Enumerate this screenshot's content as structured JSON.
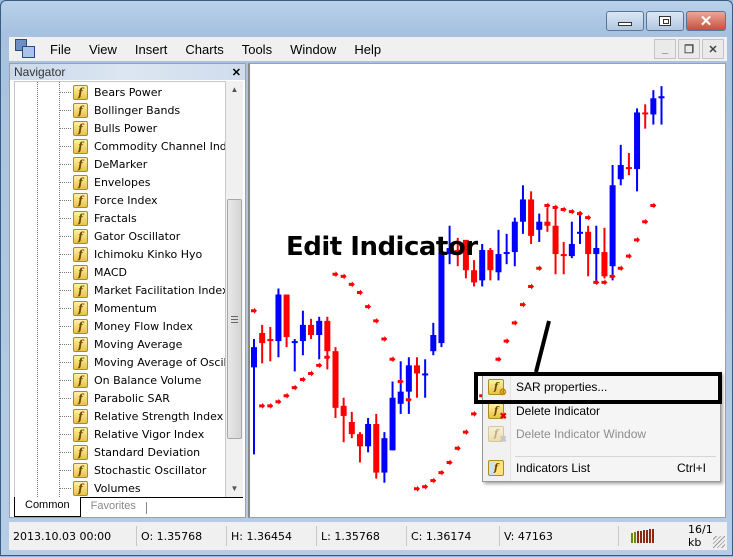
{
  "window": {
    "controls": {
      "minimize": "minimize",
      "maximize": "maximize",
      "close": "close"
    }
  },
  "menubar": {
    "items": [
      "File",
      "View",
      "Insert",
      "Charts",
      "Tools",
      "Window",
      "Help"
    ]
  },
  "navigator": {
    "title": "Navigator",
    "close_label": "x",
    "items": [
      "Bears Power",
      "Bollinger Bands",
      "Bulls Power",
      "Commodity Channel Index",
      "DeMarker",
      "Envelopes",
      "Force Index",
      "Fractals",
      "Gator Oscillator",
      "Ichimoku Kinko Hyo",
      "MACD",
      "Market Facilitation Index",
      "Momentum",
      "Money Flow Index",
      "Moving Average",
      "Moving Average of Oscillat",
      "On Balance Volume",
      "Parabolic SAR",
      "Relative Strength Index",
      "Relative Vigor Index",
      "Standard Deviation",
      "Stochastic Oscillator",
      "Volumes"
    ],
    "tabs": [
      {
        "label": "Common",
        "active": true
      },
      {
        "label": "Favorites",
        "active": false
      }
    ]
  },
  "annotation": {
    "text": "Edit Indicator"
  },
  "context_menu": {
    "items": [
      {
        "label": "SAR properties...",
        "icon": "indicator-properties-icon",
        "enabled": true,
        "shortcut": ""
      },
      {
        "label": "Delete Indicator",
        "icon": "delete-indicator-icon",
        "enabled": true,
        "shortcut": ""
      },
      {
        "label": "Delete Indicator Window",
        "icon": "delete-indicator-window-icon",
        "enabled": false,
        "shortcut": ""
      },
      {
        "label": "Indicators List",
        "icon": "indicators-list-icon",
        "enabled": true,
        "shortcut": "Ctrl+I"
      }
    ]
  },
  "statusbar": {
    "datetime": "2013.10.03 00:00",
    "open": "O: 1.35768",
    "high": "H: 1.36454",
    "low": "L: 1.35768",
    "close": "C: 1.36174",
    "volume": "V: 47163",
    "traffic": "16/1 kb"
  },
  "colors": {
    "bull": "#0000ff",
    "bear": "#ff0000",
    "sar": "#ff0000"
  },
  "chart_data": {
    "type": "candlestick",
    "title": "",
    "indicator": "Parabolic SAR",
    "candles": [
      {
        "o": 1.356,
        "h": 1.3574,
        "l": 1.3517,
        "c": 1.357
      },
      {
        "o": 1.3577,
        "h": 1.3581,
        "l": 1.3562,
        "c": 1.3572
      },
      {
        "o": 1.3574,
        "h": 1.358,
        "l": 1.3563,
        "c": 1.3573
      },
      {
        "o": 1.3573,
        "h": 1.3599,
        "l": 1.3565,
        "c": 1.3596
      },
      {
        "o": 1.3596,
        "h": 1.3592,
        "l": 1.357,
        "c": 1.3575
      },
      {
        "o": 1.3572,
        "h": 1.3574,
        "l": 1.3558,
        "c": 1.3573
      },
      {
        "o": 1.3573,
        "h": 1.3588,
        "l": 1.3566,
        "c": 1.3581
      },
      {
        "o": 1.3581,
        "h": 1.3584,
        "l": 1.3574,
        "c": 1.3576
      },
      {
        "o": 1.3576,
        "h": 1.3585,
        "l": 1.3564,
        "c": 1.3583
      },
      {
        "o": 1.3583,
        "h": 1.3585,
        "l": 1.3559,
        "c": 1.3568
      },
      {
        "o": 1.3568,
        "h": 1.357,
        "l": 1.3535,
        "c": 1.354
      },
      {
        "o": 1.3541,
        "h": 1.3545,
        "l": 1.3523,
        "c": 1.3536
      },
      {
        "o": 1.3533,
        "h": 1.3538,
        "l": 1.3525,
        "c": 1.3527
      },
      {
        "o": 1.3527,
        "h": 1.3528,
        "l": 1.3513,
        "c": 1.3521
      },
      {
        "o": 1.3521,
        "h": 1.3535,
        "l": 1.3518,
        "c": 1.3532
      },
      {
        "o": 1.3532,
        "h": 1.3537,
        "l": 1.3505,
        "c": 1.3508
      },
      {
        "o": 1.3508,
        "h": 1.3528,
        "l": 1.3503,
        "c": 1.3525
      },
      {
        "o": 1.3519,
        "h": 1.3553,
        "l": 1.3519,
        "c": 1.3545
      },
      {
        "o": 1.3542,
        "h": 1.3563,
        "l": 1.3537,
        "c": 1.3548
      },
      {
        "o": 1.3548,
        "h": 1.3565,
        "l": 1.3537,
        "c": 1.3561
      },
      {
        "o": 1.3561,
        "h": 1.3565,
        "l": 1.3545,
        "c": 1.3557
      },
      {
        "o": 1.3557,
        "h": 1.3564,
        "l": 1.3545,
        "c": 1.3557
      },
      {
        "o": 1.3568,
        "h": 1.3582,
        "l": 1.3566,
        "c": 1.3576
      },
      {
        "o": 1.3572,
        "h": 1.3622,
        "l": 1.357,
        "c": 1.3617
      },
      {
        "o": 1.3616,
        "h": 1.363,
        "l": 1.3611,
        "c": 1.3619
      },
      {
        "o": 1.3618,
        "h": 1.3624,
        "l": 1.361,
        "c": 1.3617
      },
      {
        "o": 1.3623,
        "h": 1.3623,
        "l": 1.3604,
        "c": 1.3608
      },
      {
        "o": 1.3608,
        "h": 1.3613,
        "l": 1.36,
        "c": 1.3602
      },
      {
        "o": 1.3603,
        "h": 1.3621,
        "l": 1.36,
        "c": 1.3618
      },
      {
        "o": 1.3618,
        "h": 1.3619,
        "l": 1.3603,
        "c": 1.3608
      },
      {
        "o": 1.3607,
        "h": 1.3628,
        "l": 1.3603,
        "c": 1.3616
      },
      {
        "o": 1.3617,
        "h": 1.3626,
        "l": 1.3611,
        "c": 1.3617
      },
      {
        "o": 1.3617,
        "h": 1.3634,
        "l": 1.361,
        "c": 1.3632
      },
      {
        "o": 1.3632,
        "h": 1.365,
        "l": 1.3626,
        "c": 1.3643
      },
      {
        "o": 1.3643,
        "h": 1.3647,
        "l": 1.3621,
        "c": 1.3625
      },
      {
        "o": 1.3628,
        "h": 1.3636,
        "l": 1.3622,
        "c": 1.3632
      },
      {
        "o": 1.3632,
        "h": 1.3639,
        "l": 1.3627,
        "c": 1.363
      },
      {
        "o": 1.363,
        "h": 1.364,
        "l": 1.3606,
        "c": 1.3616
      },
      {
        "o": 1.3616,
        "h": 1.3622,
        "l": 1.3606,
        "c": 1.3615
      },
      {
        "o": 1.3615,
        "h": 1.3632,
        "l": 1.3614,
        "c": 1.3621
      },
      {
        "o": 1.3627,
        "h": 1.3637,
        "l": 1.3621,
        "c": 1.3627
      },
      {
        "o": 1.3627,
        "h": 1.363,
        "l": 1.3605,
        "c": 1.3616
      },
      {
        "o": 1.3616,
        "h": 1.363,
        "l": 1.3602,
        "c": 1.3619
      },
      {
        "o": 1.3617,
        "h": 1.3629,
        "l": 1.3604,
        "c": 1.3605
      },
      {
        "o": 1.361,
        "h": 1.366,
        "l": 1.3603,
        "c": 1.365
      },
      {
        "o": 1.3653,
        "h": 1.367,
        "l": 1.365,
        "c": 1.366
      },
      {
        "o": 1.3659,
        "h": 1.3666,
        "l": 1.3655,
        "c": 1.3658
      },
      {
        "o": 1.3658,
        "h": 1.3688,
        "l": 1.3647,
        "c": 1.3686
      },
      {
        "o": 1.3686,
        "h": 1.369,
        "l": 1.3678,
        "c": 1.3685
      },
      {
        "o": 1.3685,
        "h": 1.3697,
        "l": 1.368,
        "c": 1.3693
      },
      {
        "o": 1.3693,
        "h": 1.3699,
        "l": 1.368,
        "c": 1.3694
      }
    ],
    "sar": [
      1.3588,
      1.3541,
      1.3541,
      1.3543,
      1.3546,
      1.355,
      1.3554,
      1.3557,
      1.3561,
      1.3565,
      1.3606,
      1.3605,
      1.3601,
      1.3597,
      1.359,
      1.3583,
      1.3574,
      1.3564,
      1.3553,
      1.3544,
      1.35,
      1.3501,
      1.3504,
      1.3508,
      1.3513,
      1.352,
      1.3528,
      1.3537,
      1.3546,
      1.3555,
      1.3564,
      1.3573,
      1.3582,
      1.3591,
      1.36,
      1.3609,
      1.364,
      1.3639,
      1.3638,
      1.3637,
      1.3636,
      1.3634,
      1.3602,
      1.3602,
      1.3605,
      1.3609,
      1.3615,
      1.3623,
      1.3632,
      1.364
    ],
    "ylim": [
      1.349,
      1.3705
    ],
    "xlabel": "",
    "ylabel": "",
    "grid": false
  }
}
